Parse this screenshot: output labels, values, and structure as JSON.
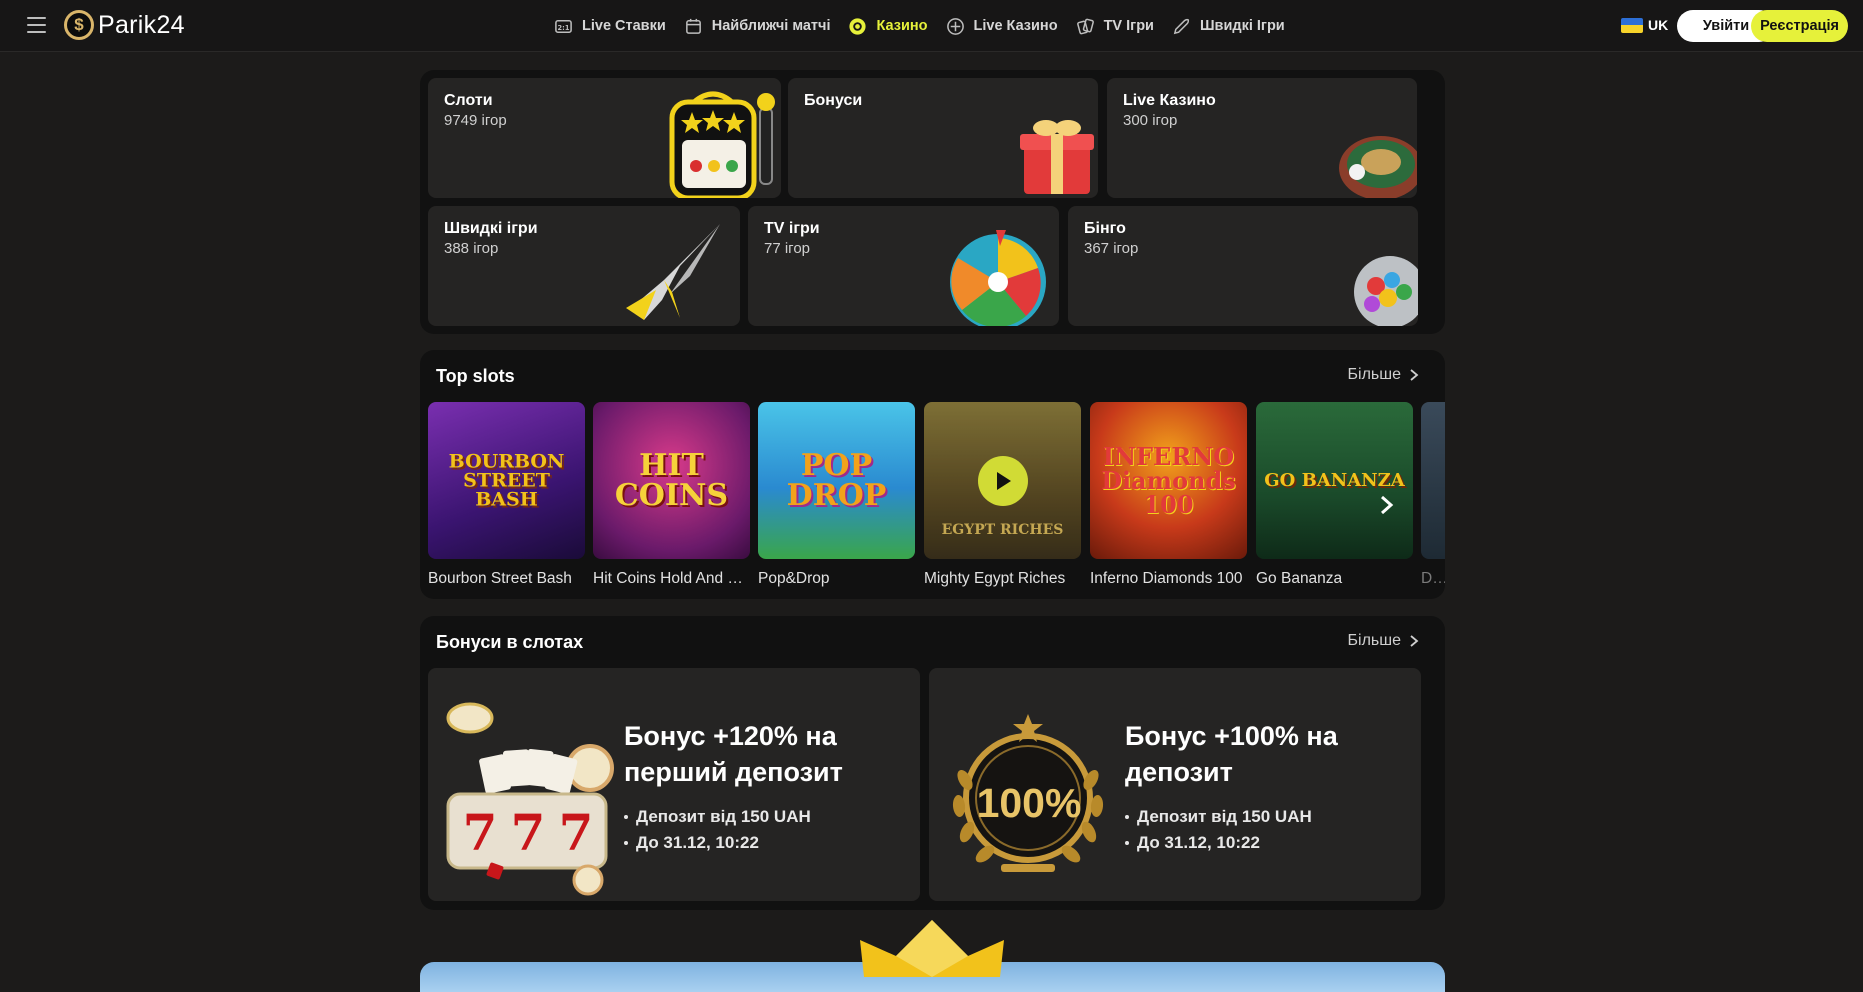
{
  "header": {
    "logo_text": "Parik24",
    "nav": [
      {
        "label": "Live Ставки",
        "icon": "scoreboard-icon"
      },
      {
        "label": "Найближчі матчі",
        "icon": "calendar-icon"
      },
      {
        "label": "Казино",
        "icon": "casino-chip-icon",
        "active": true
      },
      {
        "label": "Live Казино",
        "icon": "live-casino-icon"
      },
      {
        "label": "TV Ігри",
        "icon": "tv-games-icon"
      },
      {
        "label": "Швидкі Ігри",
        "icon": "rocket-icon"
      }
    ],
    "language": "UK",
    "login_label": "Увійти",
    "register_label": "Реєстрація",
    "accent_color": "#e6f13a"
  },
  "categories": [
    {
      "title": "Слоти",
      "count": "9749 ігор",
      "icon": "slot-machine-icon"
    },
    {
      "title": "Бонуси",
      "count": "",
      "icon": "gift-box-icon"
    },
    {
      "title": "Live Казино",
      "count": "300 ігор",
      "icon": "roulette-icon"
    },
    {
      "title": "Швидкі ігри",
      "count": "388 ігор",
      "icon": "rocket-icon"
    },
    {
      "title": "TV ігри",
      "count": "77 ігор",
      "icon": "wheel-of-fortune-icon"
    },
    {
      "title": "Бінго",
      "count": "367 ігор",
      "icon": "bingo-balls-icon"
    }
  ],
  "top_slots": {
    "title": "Top slots",
    "more_label": "Більше",
    "items": [
      {
        "name": "Bourbon Street Bash",
        "logo": "BOURBON STREET BASH"
      },
      {
        "name": "Hit Coins Hold And S...",
        "logo": "HIT COINS"
      },
      {
        "name": "Pop&Drop",
        "logo": "POP DROP"
      },
      {
        "name": "Mighty Egypt Riches",
        "logo": "EGYPT RICHES"
      },
      {
        "name": "Inferno Diamonds 100",
        "logo": "INFERNO Diamonds 100"
      },
      {
        "name": "Go Bananza",
        "logo": "GO BANANZA"
      },
      {
        "name": "Der",
        "logo": ""
      }
    ]
  },
  "bonus_slots": {
    "title": "Бонуси в слотах",
    "more_label": "Більше",
    "items": [
      {
        "title": "Бонус +120% на перший депозит",
        "details": [
          "Депозит від 150 UAH",
          "До 31.12, 10:22"
        ],
        "art": "slot-777-icon"
      },
      {
        "title": "Бонус +100% на депозит",
        "details": [
          "Депозит від 150 UAH",
          "До 31.12, 10:22"
        ],
        "art_text": "100%"
      }
    ]
  }
}
